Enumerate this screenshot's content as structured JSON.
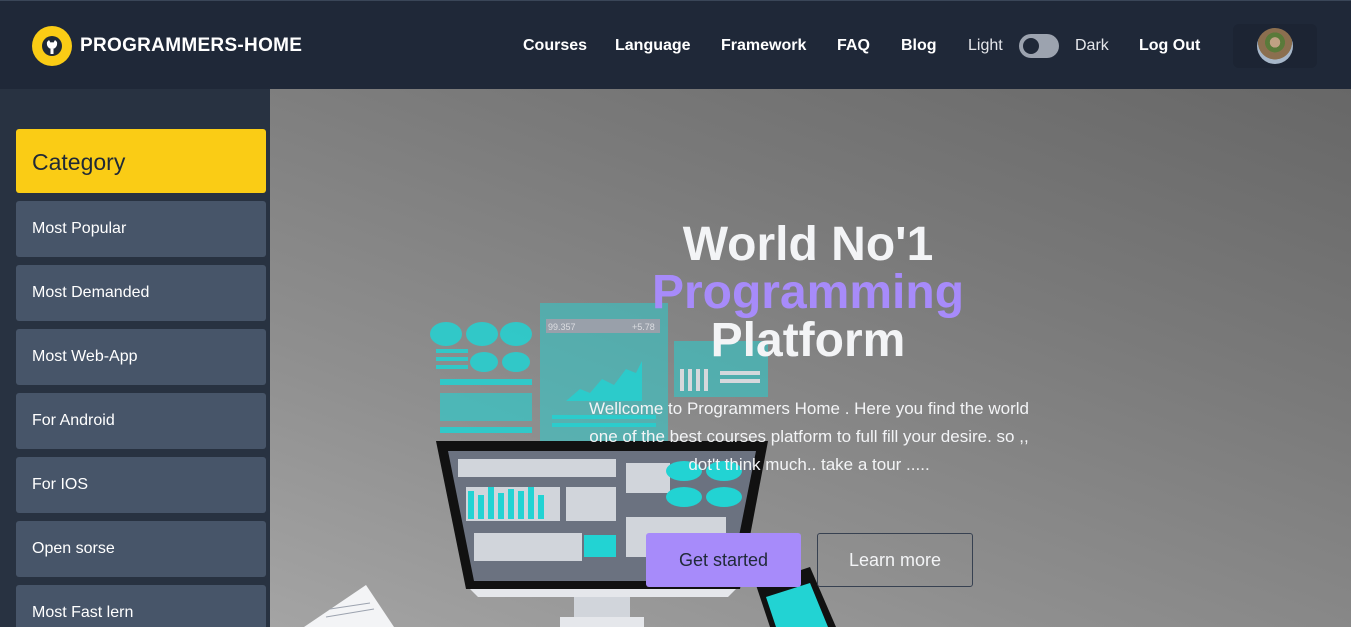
{
  "header": {
    "brand": "PROGRAMMERS-HOME",
    "nav": [
      "Courses",
      "Language",
      "Framework",
      "FAQ",
      "Blog"
    ],
    "theme_light": "Light",
    "theme_dark": "Dark",
    "logout": "Log Out"
  },
  "sidebar": {
    "title": "Category",
    "items": [
      "Most Popular",
      "Most Demanded",
      "Most Web-App",
      "For Android",
      "For IOS",
      "Open sorse",
      "Most Fast lern"
    ]
  },
  "hero": {
    "line1": "World No'1",
    "line2": "Programming",
    "line3": "Platform",
    "text": "Wellcome to Programmers Home . Here you find the world one of the best courses platform to full fill your desire. so ,, dot't think much.. take a tour .....",
    "primary_button": "Get started",
    "secondary_button": "Learn more",
    "chart_text_left": "99.357",
    "chart_text_right": "+5.78"
  },
  "colors": {
    "accent_yellow": "#facc15",
    "accent_purple": "#a78bfa",
    "header_bg": "#1f2838",
    "sidebar_item_bg": "#475569",
    "illustration_cyan": "#22d3d3"
  }
}
